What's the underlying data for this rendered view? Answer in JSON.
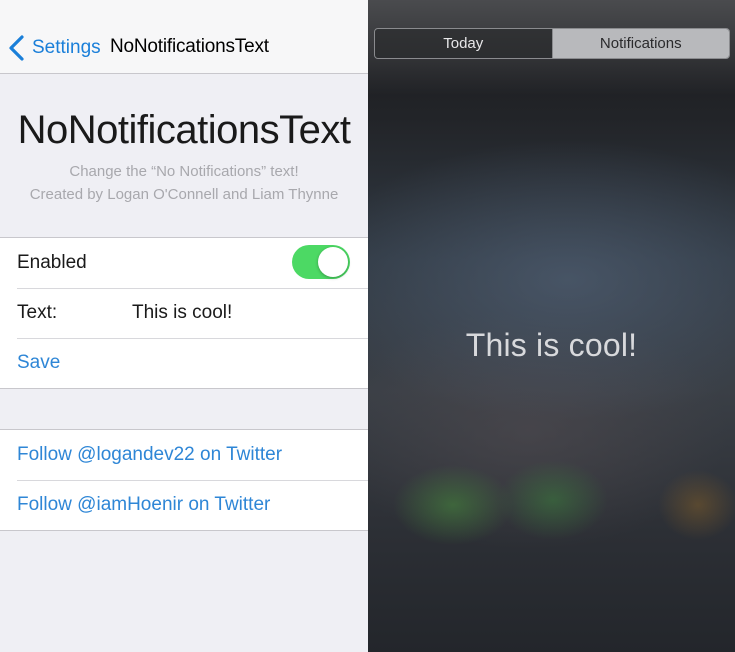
{
  "settings": {
    "navbar": {
      "back_label": "Settings",
      "title": "NoNotificationsText"
    },
    "header": {
      "title": "NoNotificationsText",
      "subtitle_line1": "Change the “No Notifications” text!",
      "subtitle_line2": "Created by Logan O'Connell and Liam Thynne"
    },
    "group1": {
      "enabled_label": "Enabled",
      "enabled_on": true,
      "text_label": "Text:",
      "text_value": "This is cool!",
      "save_label": "Save"
    },
    "group2": {
      "links": [
        "Follow @logandev22 on Twitter",
        "Follow @iamHoenir on Twitter"
      ]
    },
    "colors": {
      "tint": "#1a7fd9",
      "toggle_on": "#4cd964"
    }
  },
  "notification_center": {
    "tabs": [
      "Today",
      "Notifications"
    ],
    "selected_tab": "Notifications",
    "empty_message": "This is cool!"
  }
}
